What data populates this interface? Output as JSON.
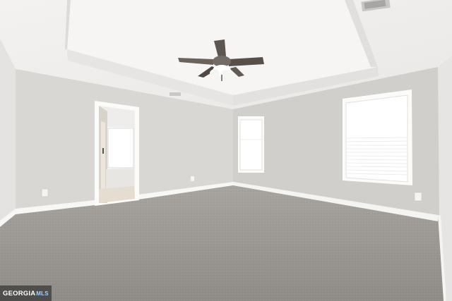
{
  "watermark": {
    "brand": "GEORGIA",
    "suffix": "MLS"
  },
  "colors": {
    "ceiling": "#f1f0ee",
    "wall_back": "#d8d6d3",
    "wall_right": "#d0cecb",
    "wall_left": "#e4e3e1",
    "carpet": "#9f9b97",
    "trim": "#f7f7f5",
    "window_light": "#ffffff",
    "fan_blade": "#5d5550",
    "fan_metal": "#6f6a66"
  }
}
